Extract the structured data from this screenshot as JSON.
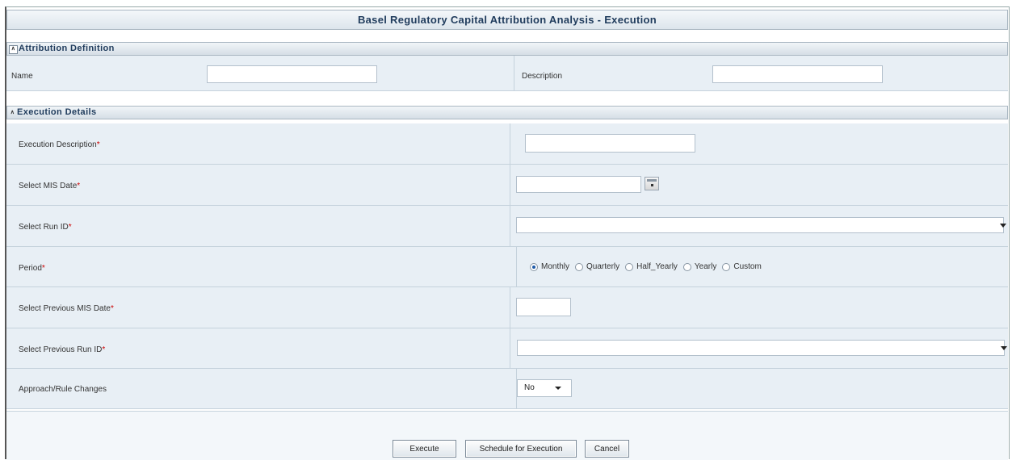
{
  "title": "Basel Regulatory Capital Attribution Analysis - Execution",
  "attribution_section": {
    "header": "Attribution Definition",
    "name_label": "Name",
    "name_value": "",
    "description_label": "Description",
    "description_value": ""
  },
  "execution_section": {
    "header": "Execution Details",
    "execution_description_label": "Execution Description",
    "mis_date_label": "Select MIS Date",
    "run_id_label": "Select Run ID",
    "period_label": "Period",
    "period_options": [
      "Monthly",
      "Quarterly",
      "Half_Yearly",
      "Yearly",
      "Custom"
    ],
    "period_selected": "Monthly",
    "previous_mis_date_label": "Select Previous MIS Date",
    "previous_run_id_label": "Select Previous Run ID",
    "approach_label": "Approach/Rule Changes",
    "approach_value": "No",
    "required_marker": "*"
  },
  "buttons": {
    "execute": "Execute",
    "schedule": "Schedule for Execution",
    "cancel": "Cancel"
  },
  "icons": {
    "collapse": "double-chevron-up-icon",
    "calendar": "calendar-icon",
    "dropdown": "chevron-down-icon"
  },
  "colors": {
    "title_text": "#1f3b5c",
    "row_background": "#e8eff5",
    "required": "#cc0000"
  }
}
